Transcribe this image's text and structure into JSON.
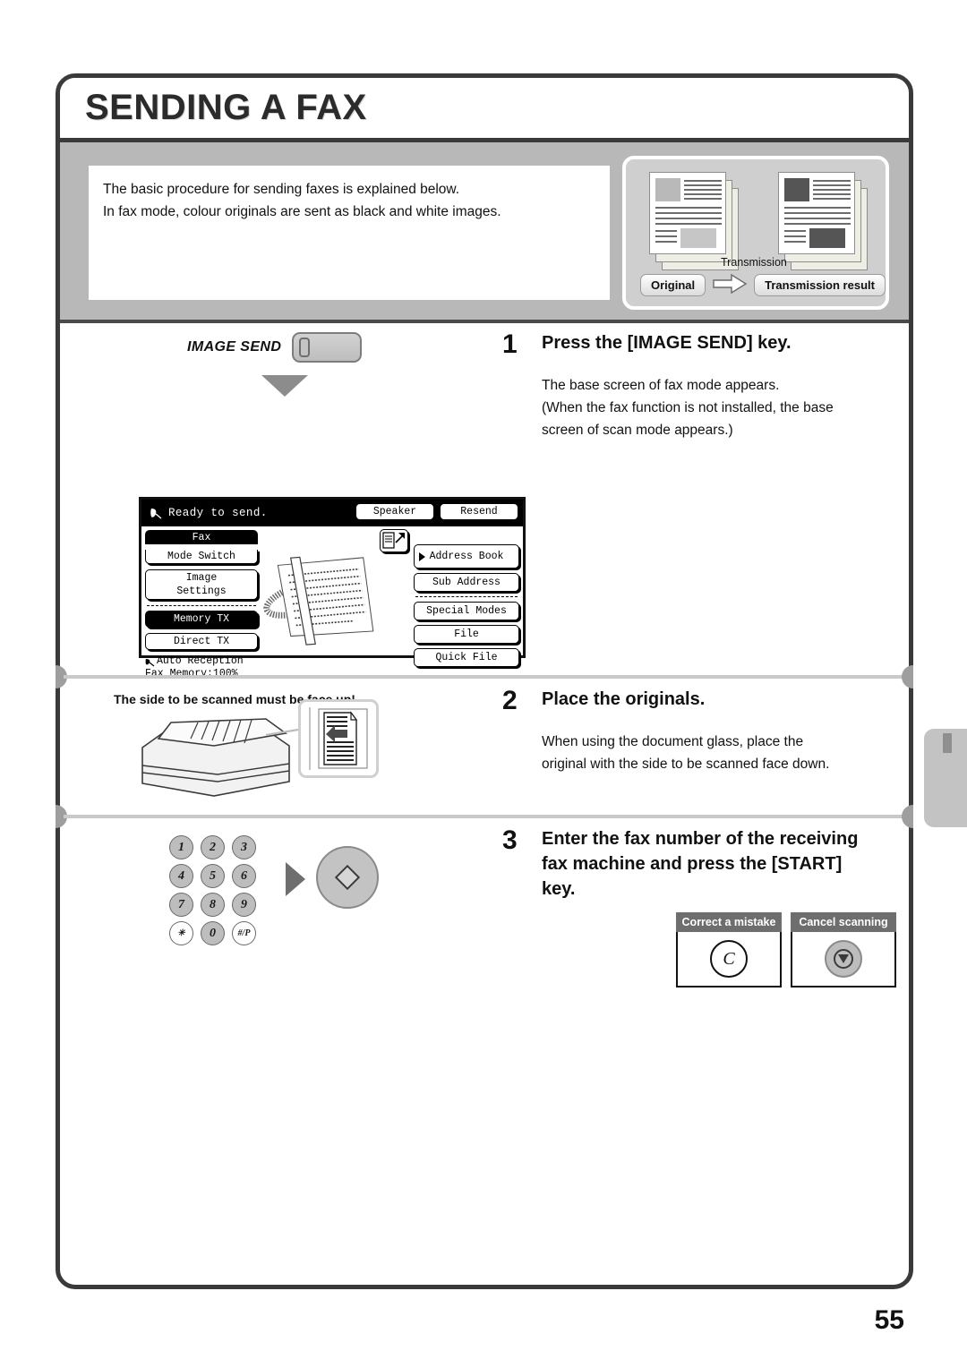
{
  "page": {
    "title": "SENDING A FAX",
    "number": "55"
  },
  "intro": {
    "line1": "The basic procedure for sending faxes is explained below.",
    "line2": "In fax mode, colour originals are sent as black and white images."
  },
  "illustration": {
    "transmission_label": "Transmission",
    "original_label": "Original",
    "result_label": "Transmission result"
  },
  "steps": [
    {
      "number": "1",
      "title": "Press the [IMAGE SEND] key.",
      "body_line1": "The base screen of fax mode appears.",
      "body_line2": "(When the fax function is not installed, the base",
      "body_line3": "screen of scan mode appears.)",
      "hardware_key_label": "IMAGE SEND"
    },
    {
      "number": "2",
      "title": "Place the originals.",
      "body_line1": "When using the document glass, place the",
      "body_line2": "original with the side to be scanned face down.",
      "note": "The side to be scanned must be face up!"
    },
    {
      "number": "3",
      "title_line1": "Enter the fax number of the receiving",
      "title_line2": "fax machine and press the [START]",
      "title_line3": "key."
    }
  ],
  "fax_panel": {
    "status": "Ready to send.",
    "top_buttons": [
      {
        "label": "Speaker"
      },
      {
        "label": "Resend"
      }
    ],
    "left_buttons": [
      {
        "label_top": "Fax",
        "label_bottom": "Mode Switch",
        "selected": true
      },
      {
        "label_top": "Image",
        "label_bottom": "Settings",
        "selected": false
      },
      {
        "label": "Memory TX",
        "selected": true
      },
      {
        "label": "Direct TX",
        "selected": false
      }
    ],
    "reception_mode": "Auto Reception",
    "memory_status": "Fax Memory:100%",
    "right_buttons": [
      {
        "label": "Address Book"
      },
      {
        "label": "Sub Address"
      },
      {
        "label": "Special Modes"
      },
      {
        "label": "File"
      },
      {
        "label": "Quick File"
      }
    ]
  },
  "keypad": {
    "rows": [
      [
        "1",
        "2",
        "3"
      ],
      [
        "4",
        "5",
        "6"
      ],
      [
        "7",
        "8",
        "9"
      ],
      [
        "✳",
        "0",
        "#/P"
      ]
    ]
  },
  "key_cards": [
    {
      "caption": "Correct a mistake",
      "glyph": "C"
    },
    {
      "caption": "Cancel scanning",
      "glyph": "stop-icon"
    }
  ],
  "colors": {
    "frame": "#3a3a3a",
    "band": "#b8b8b8",
    "illus_bg": "#cfcfcf",
    "tab": "#c3c3c3",
    "caption_bg": "#6e6e6e"
  }
}
